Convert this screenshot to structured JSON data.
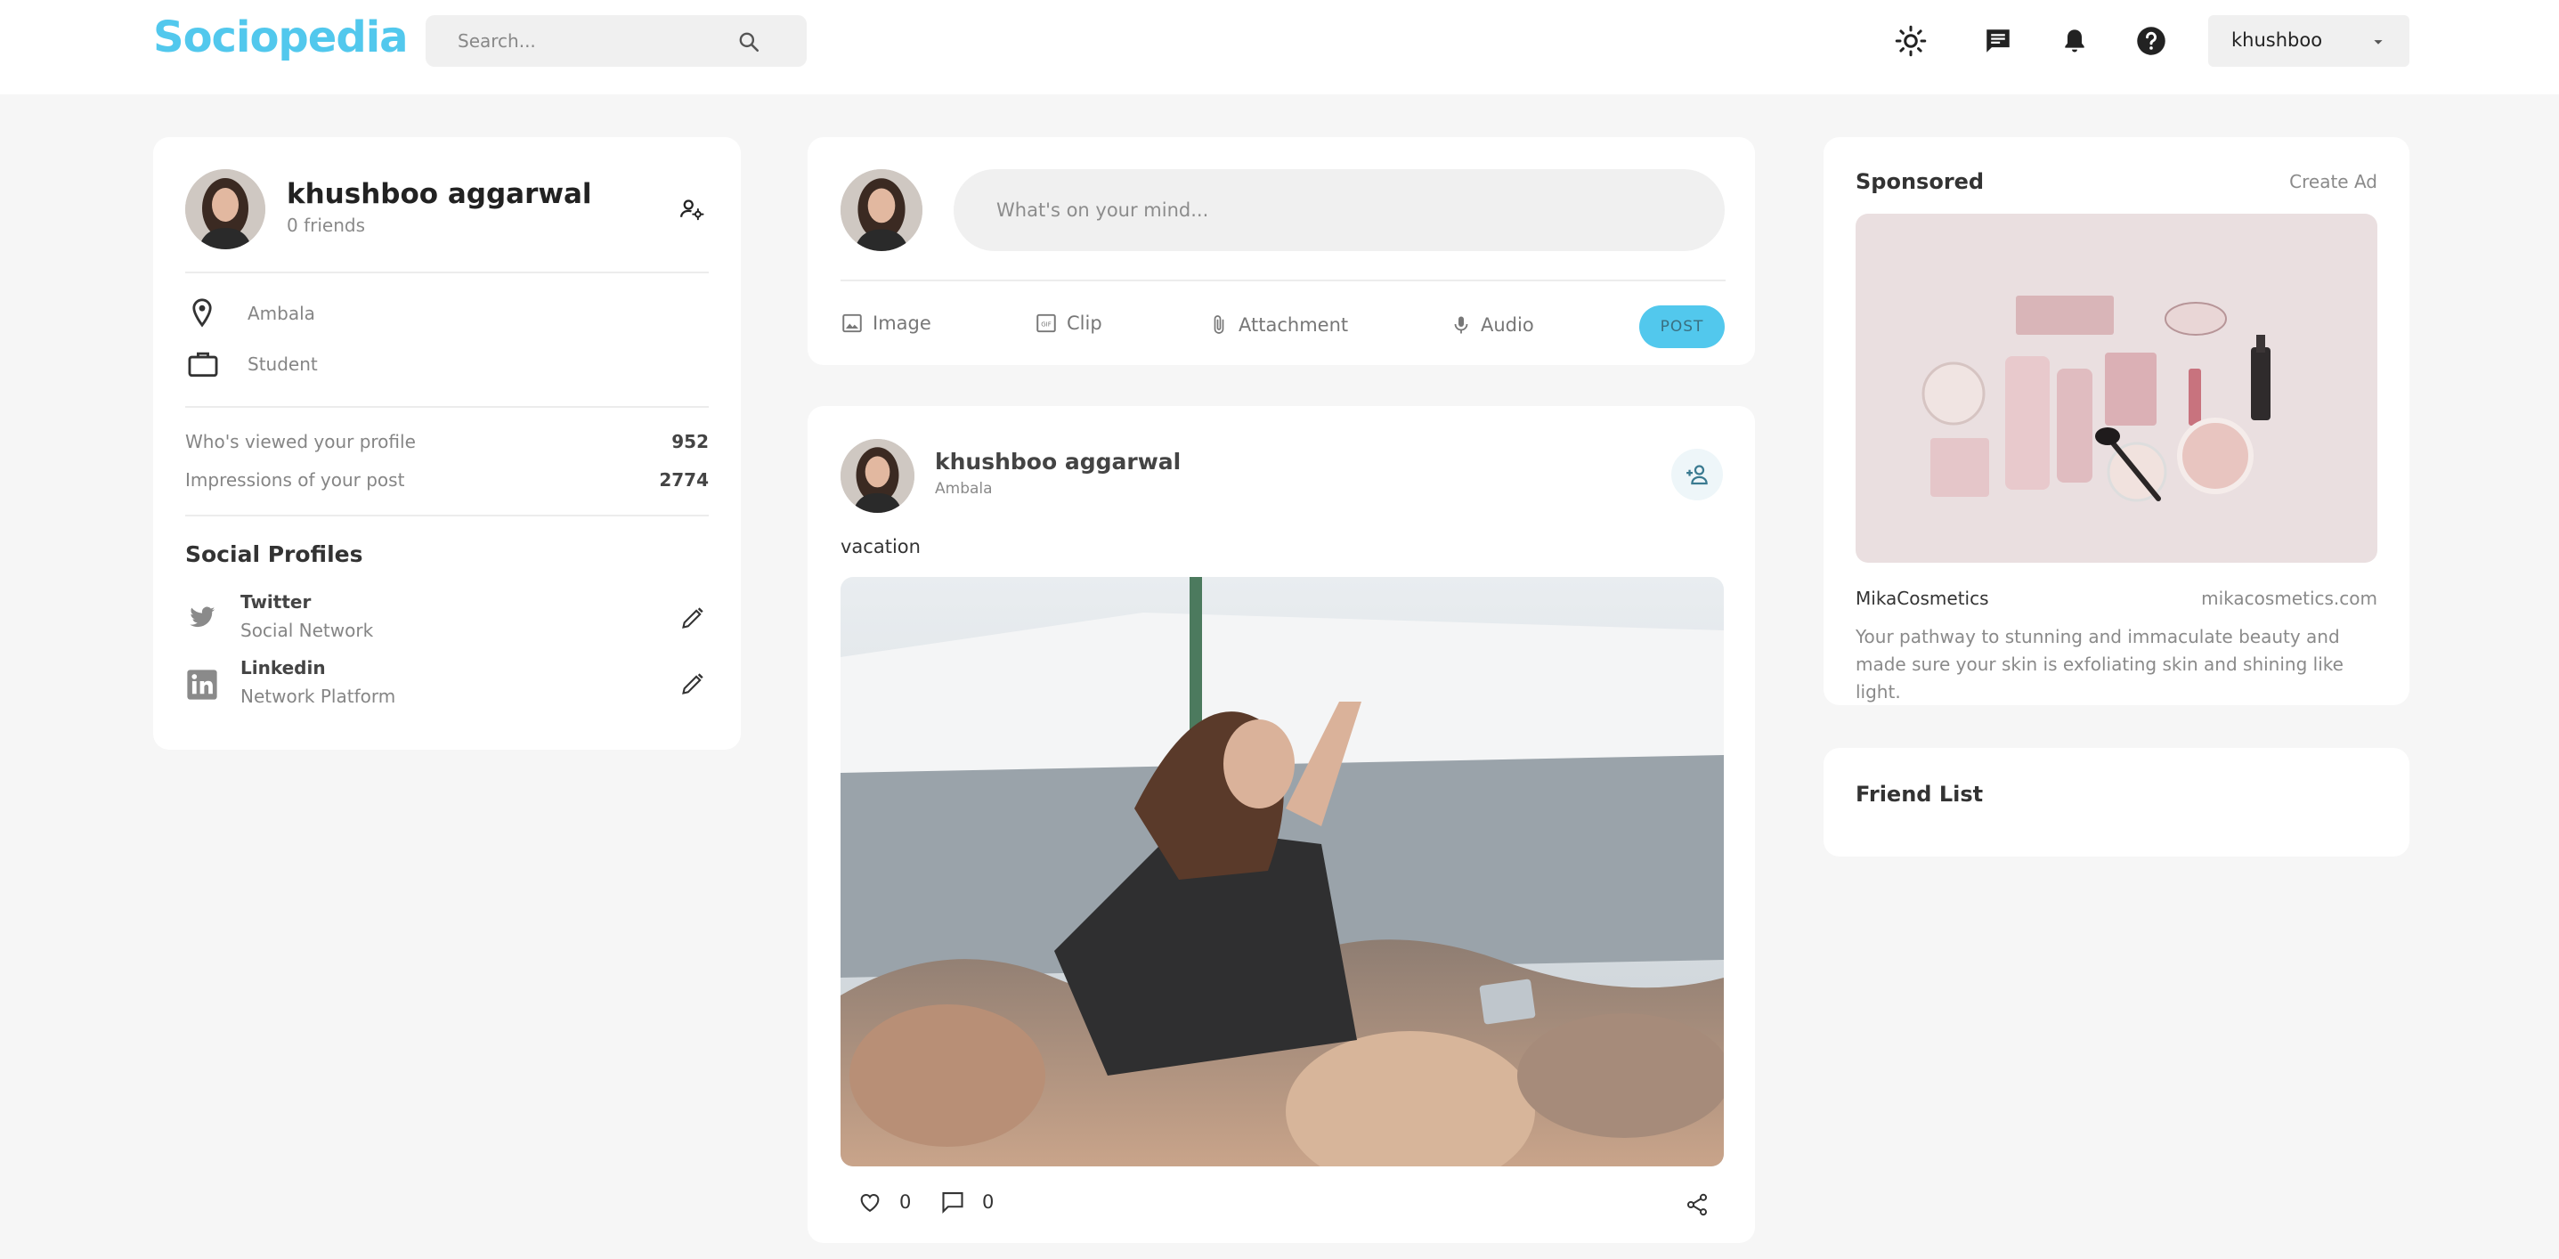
{
  "navbar": {
    "logo": "Sociopedia",
    "search_placeholder": "Search...",
    "user_name": "khushboo",
    "icons": [
      "sun-icon",
      "message-icon",
      "bell-icon",
      "help-icon"
    ]
  },
  "profile": {
    "name": "khushboo aggarwal",
    "friends": "0 friends",
    "location": "Ambala",
    "occupation": "Student",
    "stats": [
      {
        "label": "Who's viewed your profile",
        "value": "952"
      },
      {
        "label": "Impressions of your post",
        "value": "2774"
      }
    ],
    "social_title": "Social Profiles",
    "socials": [
      {
        "name": "Twitter",
        "sub": "Social Network"
      },
      {
        "name": "Linkedin",
        "sub": "Network Platform"
      }
    ]
  },
  "create_post": {
    "placeholder": "What's on your mind...",
    "tools": [
      "Image",
      "Clip",
      "Attachment",
      "Audio"
    ],
    "post_label": "POST"
  },
  "post": {
    "author": "khushboo aggarwal",
    "location": "Ambala",
    "description": "vacation",
    "likes": "0",
    "comments": "0"
  },
  "sponsored": {
    "title": "Sponsored",
    "create_ad": "Create Ad",
    "brand": "MikaCosmetics",
    "url": "mikacosmetics.com",
    "description": "Your pathway to stunning and immaculate beauty and made sure your skin is exfoliating skin and shining like light."
  },
  "friend_list": {
    "title": "Friend List"
  },
  "colors": {
    "accent": "#52c8ed",
    "background": "#f6f6f6",
    "card": "#ffffff"
  }
}
